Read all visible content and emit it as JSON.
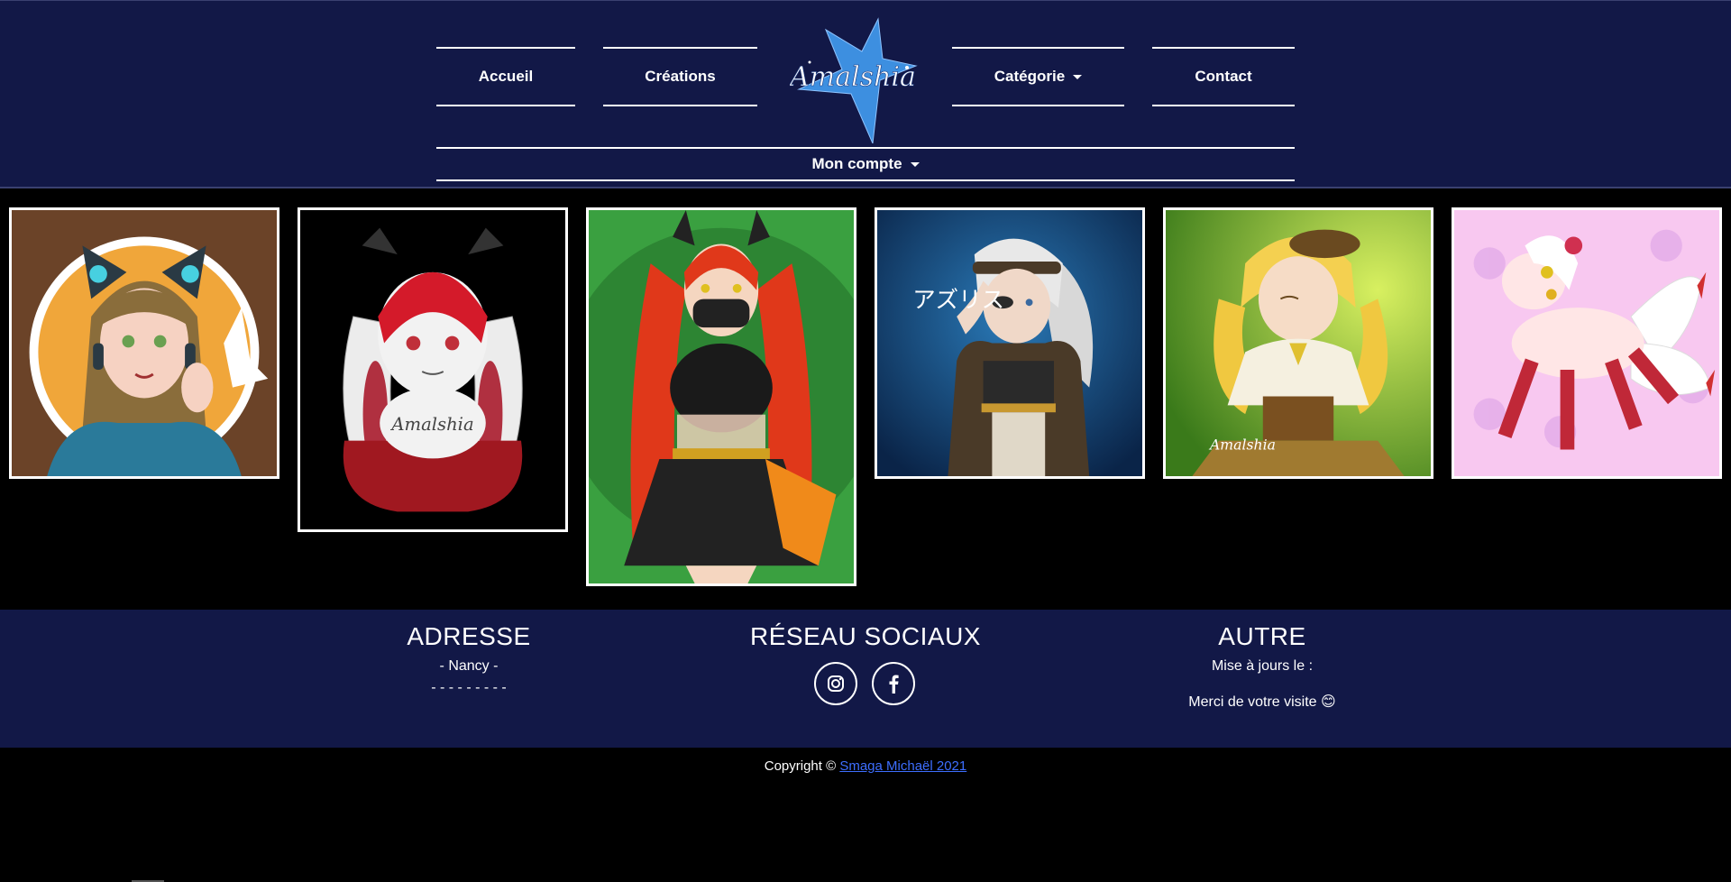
{
  "nav": {
    "accueil": "Accueil",
    "creations": "Créations",
    "categorie": "Catégorie",
    "contact": "Contact",
    "account": "Mon compte",
    "logo_text": "Amalshia"
  },
  "gallery": {
    "items": [
      {
        "alt": "cat-girl-headphones"
      },
      {
        "alt": "bunny-girl-red-hair"
      },
      {
        "alt": "demon-girl-orange-dress"
      },
      {
        "alt": "white-hair-warrior"
      },
      {
        "alt": "blonde-magical-girl"
      },
      {
        "alt": "white-pony-kitsune"
      }
    ],
    "signatures": [
      "Amalshia",
      "Amalshia",
      "アズリス"
    ]
  },
  "footer": {
    "address_title": "ADRESSE",
    "address_city": "- Nancy -",
    "address_line": "- - - - - - - - -",
    "social_title": "RÉSEAU SOCIAUX",
    "other_title": "AUTRE",
    "other_update": "Mise à jours le :",
    "other_thanks": "Merci de votre visite 😊",
    "copyright_prefix": "Copyright ©",
    "copyright_link": "Smaga Michaël 2021"
  },
  "colors": {
    "header_bg": "#121847",
    "page_bg": "#000000",
    "link": "#3d6eff"
  }
}
